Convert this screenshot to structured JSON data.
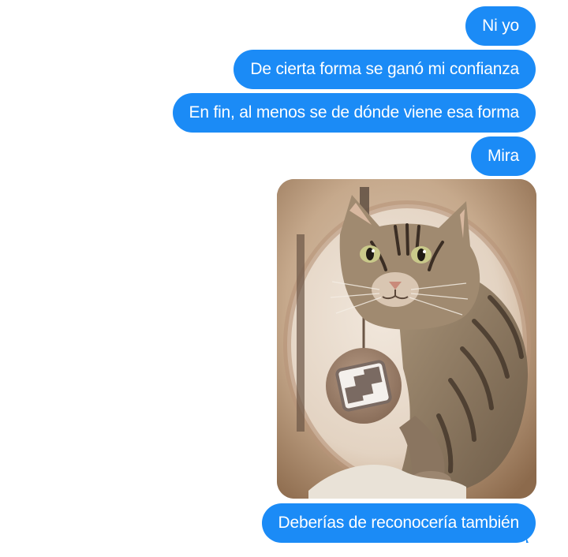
{
  "messages": [
    {
      "type": "text",
      "direction": "outgoing",
      "text": "Ni yo"
    },
    {
      "type": "text",
      "direction": "outgoing",
      "text": "De cierta forma se ganó mi confianza"
    },
    {
      "type": "text",
      "direction": "outgoing",
      "text": "En fin, al menos se de dónde viene esa forma"
    },
    {
      "type": "text",
      "direction": "outgoing",
      "text": "Mira"
    },
    {
      "type": "image",
      "direction": "outgoing",
      "subject": "tabby cat inside a cat tunnel"
    },
    {
      "type": "text",
      "direction": "outgoing",
      "text": "Deberías de reconocería también"
    }
  ],
  "colors": {
    "bubble": "#1b8bf6",
    "bubble_text": "#ffffff",
    "background": "#ffffff"
  }
}
